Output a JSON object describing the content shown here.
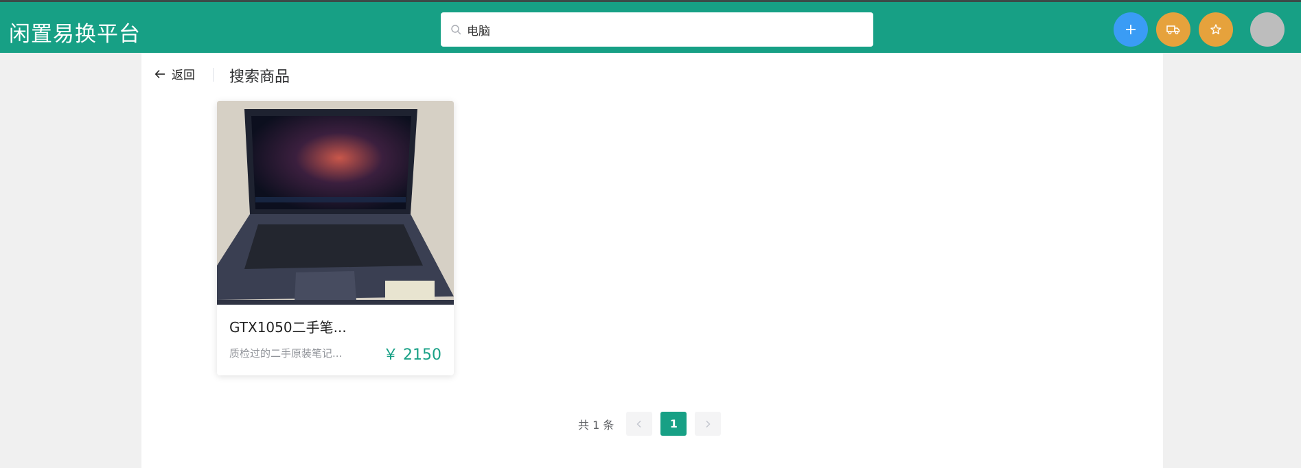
{
  "header": {
    "logo": "闲置易换平台",
    "search_value": "电脑",
    "accent": "#17a085"
  },
  "nav": {
    "back_label": "返回",
    "page_title": "搜索商品"
  },
  "products": [
    {
      "name": "GTX1050二手笔...",
      "desc": "质检过的二手原装笔记...",
      "price": "￥ 2150"
    }
  ],
  "pagination": {
    "total": "共 1 条",
    "current": "1"
  },
  "icons": [
    "search-icon",
    "plus-icon",
    "truck-icon",
    "star-icon",
    "arrow-left-icon",
    "chevron-left-icon",
    "chevron-right-icon"
  ]
}
